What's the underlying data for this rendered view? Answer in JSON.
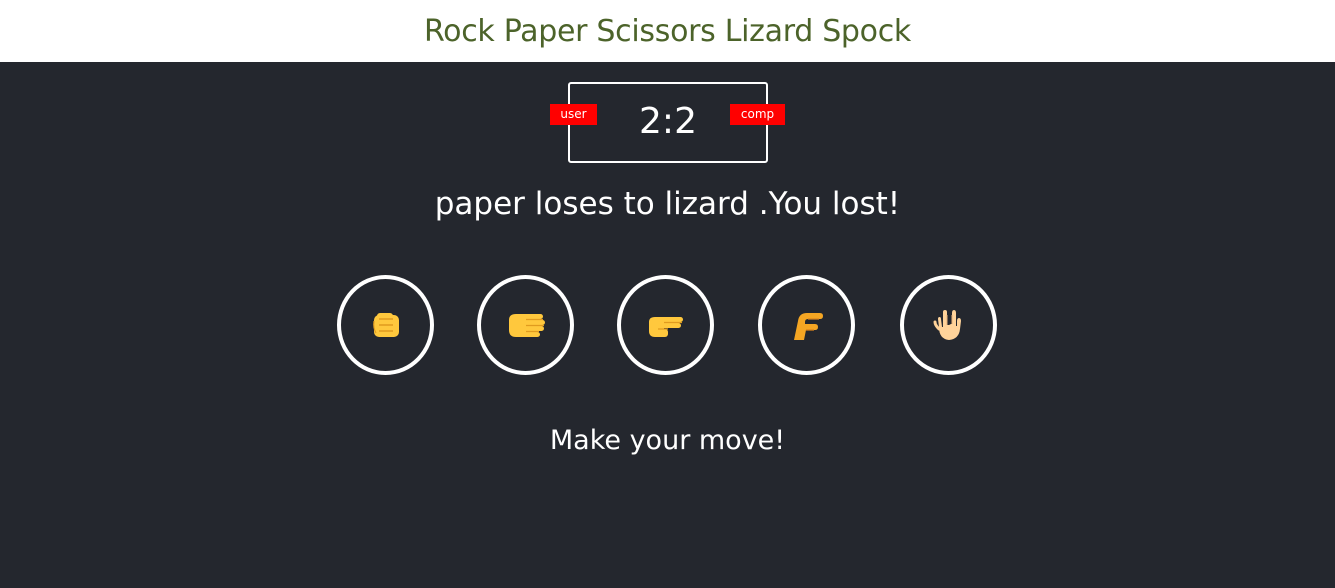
{
  "header": {
    "title": "Rock Paper Scissors Lizard Spock"
  },
  "scoreboard": {
    "score": "2:2",
    "user_label": "user",
    "comp_label": "comp"
  },
  "result_message": "paper loses to lizard .You lost!",
  "choices": [
    {
      "id": "rock",
      "icon": "raised-fist-icon"
    },
    {
      "id": "paper",
      "icon": "raised-back-of-hand-icon"
    },
    {
      "id": "scissors",
      "icon": "backhand-index-pointing-right-icon"
    },
    {
      "id": "lizard",
      "icon": "pinched-fingers-lizard-hand-icon"
    },
    {
      "id": "spock",
      "icon": "vulcan-salute-icon"
    }
  ],
  "prompt": "Make your move!",
  "colors": {
    "header_bg": "#ffffff",
    "title": "#4c632a",
    "page_bg": "#24272e",
    "badge": "#ff0000",
    "hand": "#ffc83d",
    "hand_light": "#ffd39a"
  }
}
